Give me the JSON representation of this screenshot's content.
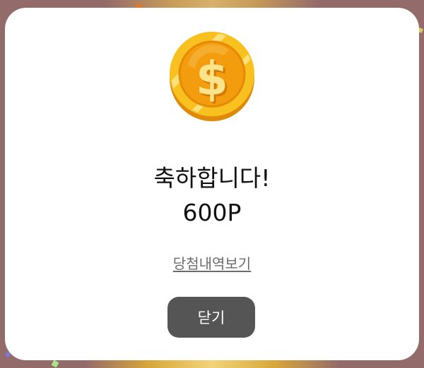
{
  "modal": {
    "title": "축하합니다!",
    "points": "600P",
    "history_link": "당첨내역보기",
    "close_label": "닫기"
  },
  "icons": {
    "coin": "gold-dollar-coin-icon"
  },
  "colors": {
    "backdrop": "#946b6b",
    "modal_bg": "#ffffff",
    "button_bg": "#555555",
    "button_text": "#ffffff",
    "link_text": "#6b6b6b",
    "coin_gold": "#f5a623"
  }
}
